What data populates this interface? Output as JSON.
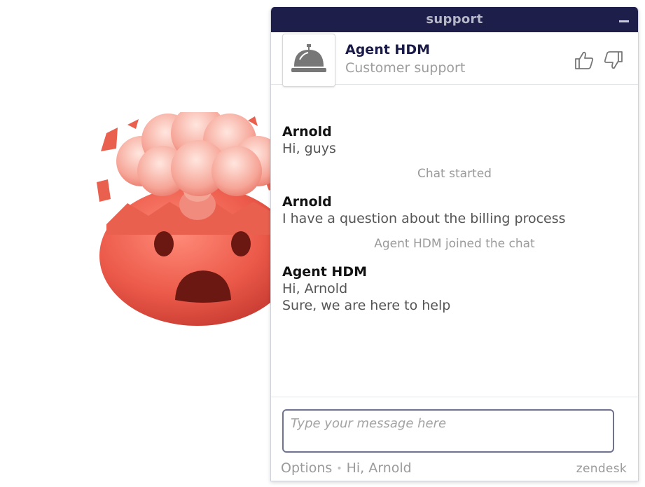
{
  "window": {
    "title": "support"
  },
  "agent": {
    "name": "Agent HDM",
    "role": "Customer support",
    "avatar_icon": "service-bell-icon",
    "rate_up_icon": "thumbs-up-icon",
    "rate_down_icon": "thumbs-down-icon"
  },
  "messages": [
    {
      "sender": "Arnold",
      "lines": [
        "Hi, guys"
      ]
    },
    {
      "system": "Chat started"
    },
    {
      "sender": "Arnold",
      "lines": [
        "I have a question about the billing process"
      ]
    },
    {
      "system": "Agent HDM joined the chat"
    },
    {
      "sender": "Agent HDM",
      "lines": [
        "Hi, Arnold",
        "Sure, we are here to help"
      ]
    }
  ],
  "composer": {
    "placeholder": "Type your message here"
  },
  "footer": {
    "options_label": "Options",
    "separator": "•",
    "status": "Hi, Arnold",
    "brand": "zendesk"
  },
  "overlay": {
    "emoji_icon": "exploding-head-emoji",
    "accent": "#e8594c"
  }
}
